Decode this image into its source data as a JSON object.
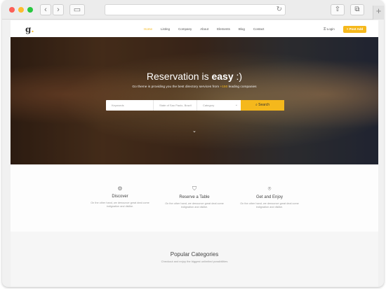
{
  "browser": {
    "back": "‹",
    "forward": "›",
    "reload": "↻",
    "share": "⇧",
    "tabs": "⧉",
    "new_tab": "+"
  },
  "site": {
    "logo": "g",
    "logo_dot": ".",
    "nav": [
      "Home",
      "Listing",
      "Company",
      "About",
      "Elements",
      "Blog",
      "Contact"
    ],
    "login": "Login",
    "post_ad": "+ Post Add"
  },
  "hero": {
    "title_pre": "Reservation is ",
    "title_bold": "easy",
    "title_post": " :)",
    "sub_pre": "Go theme is providing you the best directory services from ",
    "sub_hl": "+150",
    "sub_post": " leading companies",
    "keywords_placeholder": "Keywords",
    "location_placeholder": "State of Sao Paulo, Brazil",
    "category_placeholder": "Category",
    "search_label": "Search",
    "scroll_icon": "⌄"
  },
  "features": [
    {
      "icon": "⚙",
      "title": "Discover",
      "desc": "On the other hand, we denounce great deal come indignation and dislike."
    },
    {
      "icon": "⛉",
      "title": "Reserve a Table",
      "desc": "On the other hand, we denounce great deal come indignation and dislike."
    },
    {
      "icon": "⌾",
      "title": "Get and Enjoy",
      "desc": "On the other hand, we denounce great deal come indignation and dislike."
    }
  ],
  "popular": {
    "title": "Popular Categories",
    "subtitle": "Checkout and enjoy the biggest unlimited possibilities"
  },
  "colors": {
    "accent": "#f5b81c"
  }
}
